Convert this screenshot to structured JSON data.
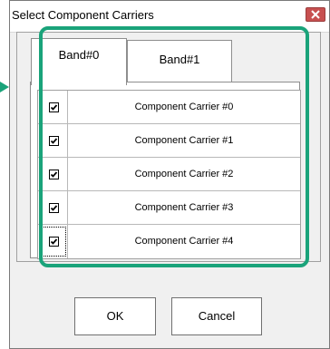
{
  "dialog": {
    "title": "Select Component Carriers",
    "close_icon": "close-icon"
  },
  "tabs": [
    {
      "label": "Band#0",
      "selected": true
    },
    {
      "label": "Band#1",
      "selected": false
    }
  ],
  "carriers": [
    {
      "label": "Component Carrier #0",
      "checked": true
    },
    {
      "label": "Component Carrier #1",
      "checked": true
    },
    {
      "label": "Component Carrier #2",
      "checked": true
    },
    {
      "label": "Component Carrier #3",
      "checked": true
    },
    {
      "label": "Component Carrier #4",
      "checked": true
    }
  ],
  "buttons": {
    "ok_label": "OK",
    "cancel_label": "Cancel"
  },
  "colors": {
    "highlight": "#1aa37a",
    "close_button": "#c75050",
    "pointer_arrow": "#1aa37a"
  }
}
